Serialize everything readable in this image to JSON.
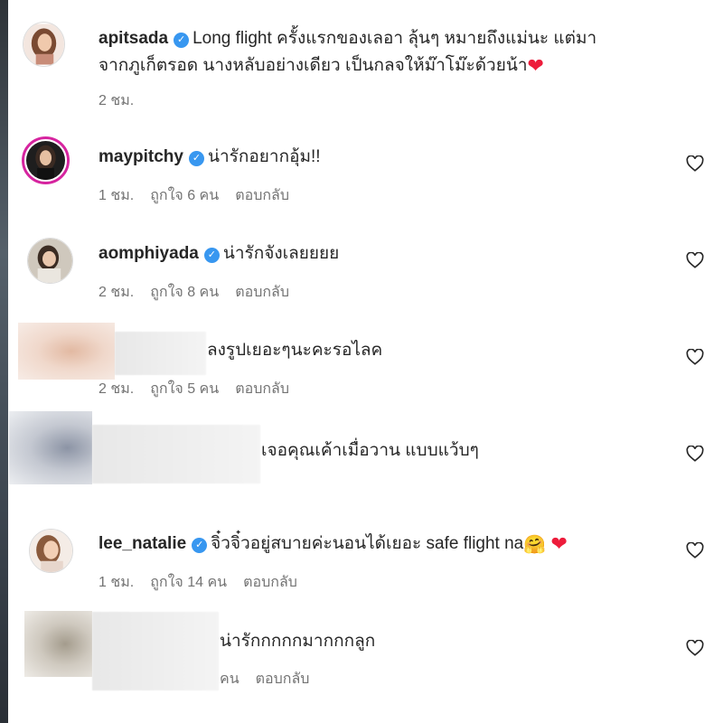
{
  "comments": [
    {
      "username": "apitsada",
      "text_line1": "Long flight ครั้งแรกของเลอา ลุ้นๆ หมายถึงแม่นะ แต่มา",
      "text_line2": "จากภูเก็ตรอด นางหลับอย่างเดียว เป็นกลจให้ม๊าโม๊ะด้วยน้า",
      "time": "2 ชม."
    },
    {
      "username": "maypitchy",
      "text": "น่ารักอยากอุ้ม!!",
      "time": "1 ชม.",
      "likes": "ถูกใจ 6 คน",
      "reply": "ตอบกลับ"
    },
    {
      "username": "aomphiyada",
      "text": "น่ารักจังเลยยยย",
      "time": "2 ชม.",
      "likes": "ถูกใจ 8 คน",
      "reply": "ตอบกลับ"
    },
    {
      "text": "ลงรูปเยอะๆนะคะรอไลค",
      "time": "2 ชม.",
      "likes": "ถูกใจ 5 คน",
      "reply": "ตอบกลับ"
    },
    {
      "text": "เจอคุณเค้าเมื่อวาน แบบแว้บๆ"
    },
    {
      "username": "lee_natalie",
      "text": "จิ๋วจิ๋วอยู่สบายค่ะนอนได้เยอะ safe flight na",
      "time": "1 ชม.",
      "likes": "ถูกใจ 14 คน",
      "reply": "ตอบกลับ"
    },
    {
      "text": "น่ารักกกกกมากกกลูก",
      "likes_partial": "คน",
      "reply": "ตอบกลับ"
    }
  ],
  "icons": {
    "verified": "verified-badge-icon",
    "like": "heart-outline-icon",
    "emoji_heart": "red-heart-emoji"
  },
  "colors": {
    "verified_blue": "#3897f0",
    "text": "#262626",
    "meta": "#737373",
    "story_ring": "#d6249f"
  }
}
